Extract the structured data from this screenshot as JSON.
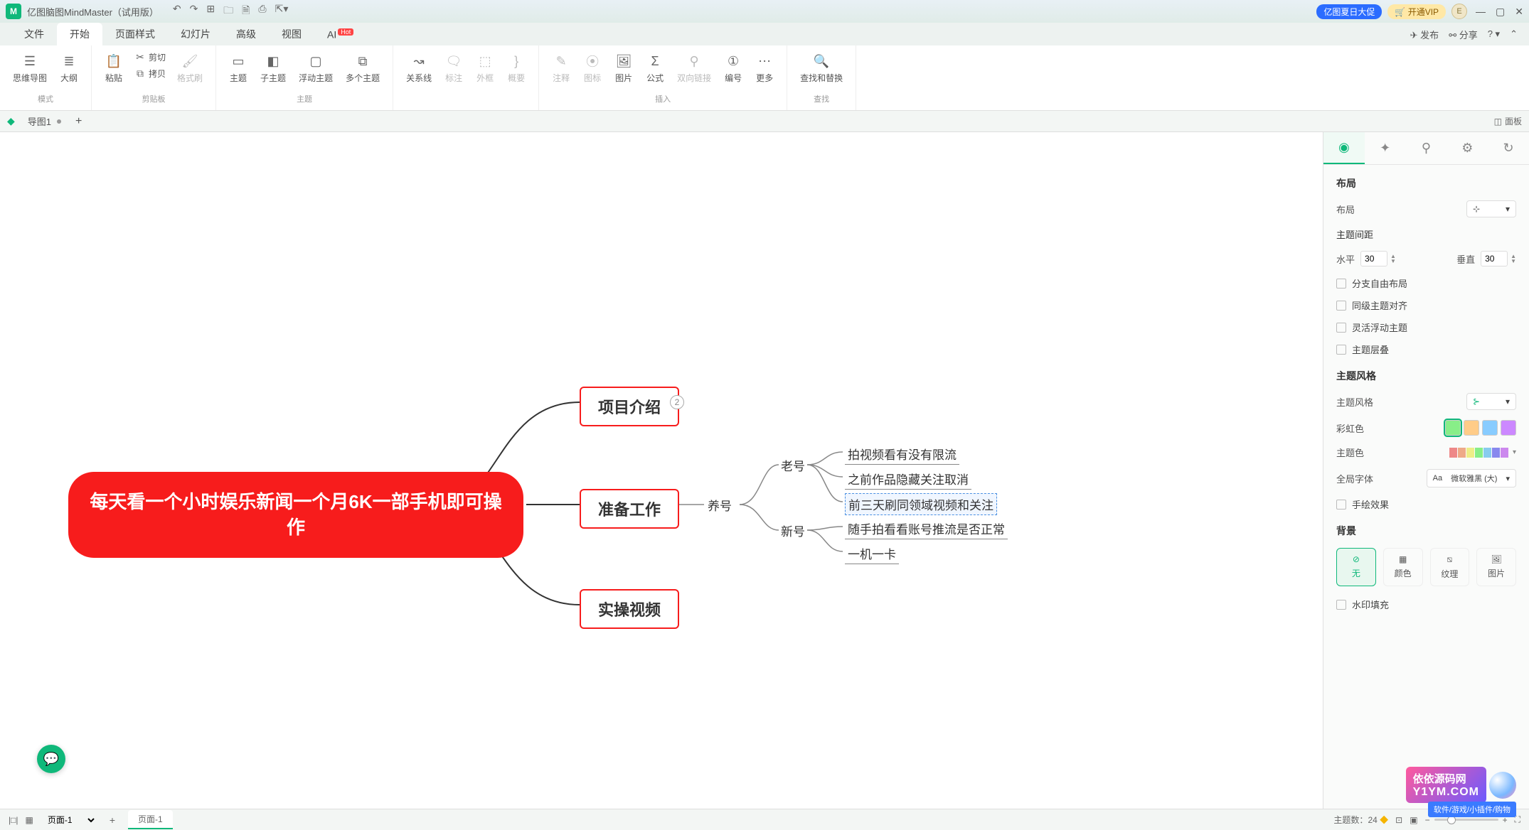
{
  "app": {
    "title": "亿图脑图MindMaster（试用版）",
    "promo": "亿图夏日大促",
    "vip": "开通VIP",
    "avatar_letter": "E"
  },
  "menu": {
    "tabs": [
      "文件",
      "开始",
      "页面样式",
      "幻灯片",
      "高级",
      "视图",
      "AI"
    ],
    "hot_label": "Hot",
    "publish": "发布",
    "share": "分享"
  },
  "ribbon": {
    "mode": {
      "mindmap": "思维导图",
      "outline": "大纲",
      "label": "模式"
    },
    "clipboard": {
      "paste": "粘贴",
      "cut": "剪切",
      "copy": "拷贝",
      "format": "格式刷",
      "label": "剪贴板"
    },
    "topic": {
      "topic": "主题",
      "subtopic": "子主题",
      "floating": "浮动主题",
      "multi": "多个主题",
      "label": "主题"
    },
    "relation": {
      "relation": "关系线",
      "callout": "标注",
      "boundary": "外框",
      "summary": "概要"
    },
    "insert": {
      "note": "注释",
      "icon": "图标",
      "image": "图片",
      "formula": "公式",
      "hyperlink": "双向链接",
      "number": "编号",
      "more": "更多",
      "label": "插入"
    },
    "find": {
      "findreplace": "查找和替换",
      "label": "查找"
    }
  },
  "doc_tabs": {
    "tab1": "导图1",
    "panel": "面板"
  },
  "mindmap": {
    "root": "每天看一个小时娱乐新闻一个月6K一部手机即可操作",
    "n1": "项目介绍",
    "n1_badge": "2",
    "n2": "准备工作",
    "n2_1": "养号",
    "n2_1_a": "老号",
    "n2_1_a_1": "拍视频看有没有限流",
    "n2_1_a_2": "之前作品隐藏关注取消",
    "n2_1_a_3": "前三天刷同领域视频和关注",
    "n2_1_b": "新号",
    "n2_1_b_1": "随手拍看看账号推流是否正常",
    "n2_1_b_2": "一机一卡",
    "n3": "实操视频"
  },
  "panel": {
    "layout_title": "布局",
    "layout_label": "布局",
    "spacing_title": "主题间距",
    "h_label": "水平",
    "v_label": "垂直",
    "h_val": "30",
    "v_val": "30",
    "ck_free": "分支自由布局",
    "ck_align": "同级主题对齐",
    "ck_flex": "灵活浮动主题",
    "ck_overlap": "主题层叠",
    "style_title": "主题风格",
    "style_label": "主题风格",
    "rainbow_label": "彩虹色",
    "themecolor_label": "主题色",
    "font_label": "全局字体",
    "font_val": "微软雅黑 (大)",
    "ck_hand": "手绘效果",
    "bg_title": "背景",
    "bg_none": "无",
    "bg_color": "颜色",
    "bg_texture": "纹理",
    "bg_image": "图片",
    "ck_watermark": "水印填充"
  },
  "status": {
    "page_sel": "页面-1",
    "page_tab": "页面-1",
    "topic_count_label": "主题数：",
    "topic_count": "24",
    "wm_brand": "依依源码网",
    "wm_url": "Y1YM.COM",
    "wm_sub": "软件/游戏/小插件/购物"
  }
}
